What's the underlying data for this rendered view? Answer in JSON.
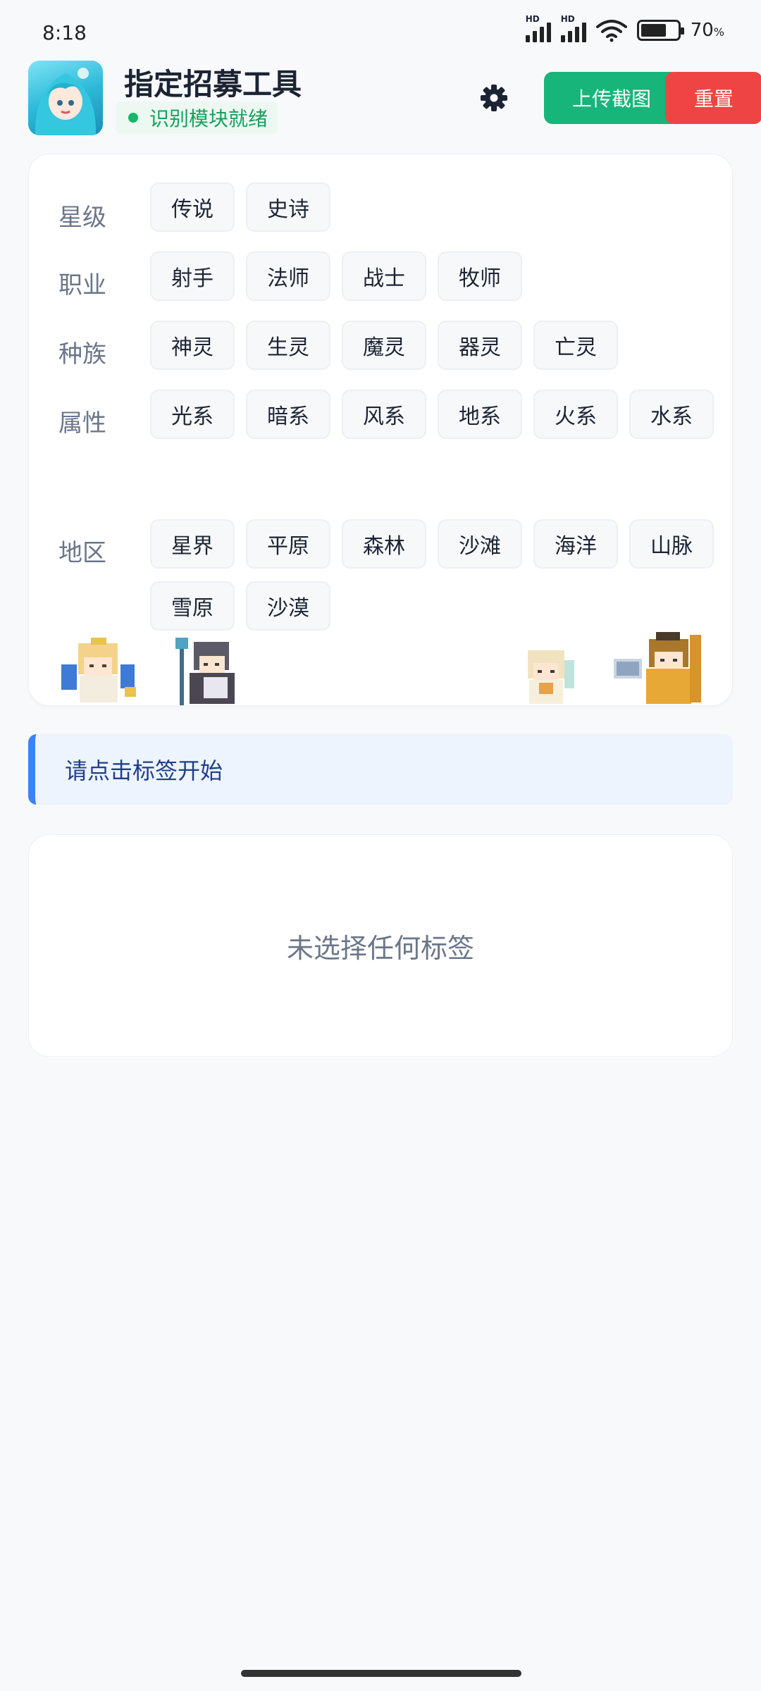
{
  "status_bar": {
    "time": "8:18",
    "battery_percent": "70",
    "battery_unit": "%",
    "hd_label_1": "HD",
    "hd_label_2": "HD"
  },
  "header": {
    "title": "指定招募工具",
    "module_status": "识别模块就绪",
    "upload_label": "上传截图",
    "reset_label": "重置",
    "icons": {
      "settings": "gear-icon",
      "avatar": "app-avatar"
    }
  },
  "filters": [
    {
      "label": "星级",
      "tags": [
        "传说",
        "史诗"
      ]
    },
    {
      "label": "职业",
      "tags": [
        "射手",
        "法师",
        "战士",
        "牧师"
      ]
    },
    {
      "label": "种族",
      "tags": [
        "神灵",
        "生灵",
        "魔灵",
        "器灵",
        "亡灵"
      ]
    },
    {
      "label": "属性",
      "tags": [
        "光系",
        "暗系",
        "风系",
        "地系",
        "火系",
        "水系"
      ]
    },
    {
      "label": "地区",
      "tags": [
        "星界",
        "平原",
        "森林",
        "沙滩",
        "海洋",
        "山脉",
        "雪原",
        "沙漠"
      ]
    }
  ],
  "hint": {
    "text": "请点击标签开始"
  },
  "result": {
    "empty_text": "未选择任何标签"
  },
  "colors": {
    "accent_green": "#17b57a",
    "accent_red": "#ef4444",
    "hint_blue": "#3b82f6",
    "background": "#f7f9fb"
  }
}
